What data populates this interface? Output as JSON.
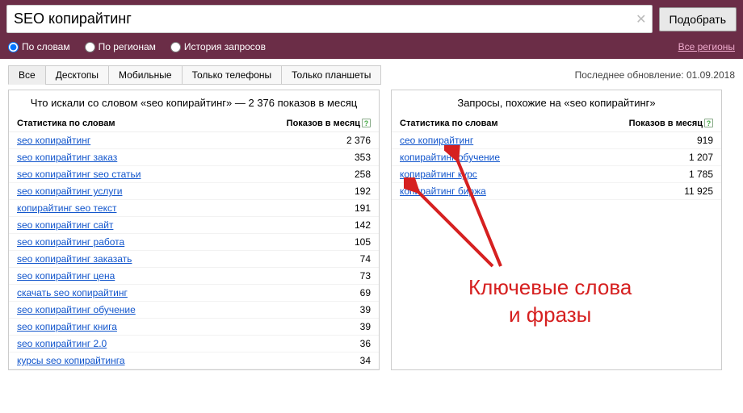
{
  "search": {
    "value": "SEO копирайтинг",
    "submit_label": "Подобрать"
  },
  "filters": {
    "by_words": "По словам",
    "by_regions": "По регионам",
    "history": "История запросов",
    "all_regions": "Все регионы"
  },
  "tabs": {
    "all": "Все",
    "desktops": "Десктопы",
    "mobile": "Мобильные",
    "phones": "Только телефоны",
    "tablets": "Только планшеты"
  },
  "update_label": "Последнее обновление: 01.09.2018",
  "left_panel": {
    "title": "Что искали со словом «seo копирайтинг» — 2 376 показов в месяц",
    "col1": "Статистика по словам",
    "col2": "Показов в месяц",
    "rows": [
      {
        "q": "seo копирайтинг",
        "n": "2 376"
      },
      {
        "q": "seo копирайтинг заказ",
        "n": "353"
      },
      {
        "q": "seo копирайтинг seo статьи",
        "n": "258"
      },
      {
        "q": "seo копирайтинг услуги",
        "n": "192"
      },
      {
        "q": "копирайтинг seo текст",
        "n": "191"
      },
      {
        "q": "seo копирайтинг сайт",
        "n": "142"
      },
      {
        "q": "seo копирайтинг работа",
        "n": "105"
      },
      {
        "q": "seo копирайтинг заказать",
        "n": "74"
      },
      {
        "q": "seo копирайтинг цена",
        "n": "73"
      },
      {
        "q": "скачать seo копирайтинг",
        "n": "69"
      },
      {
        "q": "seo копирайтинг обучение",
        "n": "39"
      },
      {
        "q": "seo копирайтинг книга",
        "n": "39"
      },
      {
        "q": "seo копирайтинг 2.0",
        "n": "36"
      },
      {
        "q": "курсы seo копирайтинга",
        "n": "34"
      }
    ]
  },
  "right_panel": {
    "title": "Запросы, похожие на «seo копирайтинг»",
    "col1": "Статистика по словам",
    "col2": "Показов в месяц",
    "rows": [
      {
        "q": "сео копирайтинг",
        "n": "919"
      },
      {
        "q": "копирайтинг обучение",
        "n": "1 207"
      },
      {
        "q": "копирайтинг курс",
        "n": "1 785"
      },
      {
        "q": "копирайтинг биржа",
        "n": "11 925"
      }
    ]
  },
  "annotation": "Ключевые слова\nи фразы"
}
